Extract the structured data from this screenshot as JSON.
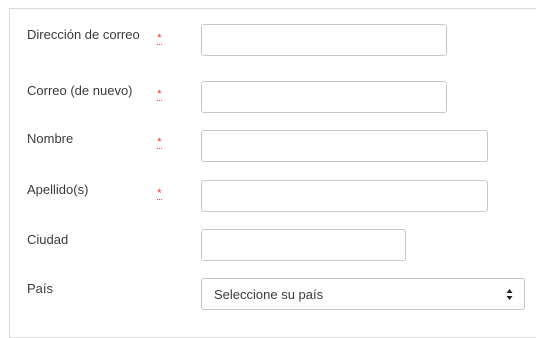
{
  "form": {
    "fields": [
      {
        "label": "Dirección de correo",
        "required": true,
        "value": ""
      },
      {
        "label": "Correo (de nuevo)",
        "required": true,
        "value": ""
      },
      {
        "label": "Nombre",
        "required": true,
        "value": ""
      },
      {
        "label": "Apellido(s)",
        "required": true,
        "value": ""
      },
      {
        "label": "Ciudad",
        "required": false,
        "value": ""
      },
      {
        "label": "País",
        "required": false,
        "value": "Seleccione su país"
      }
    ],
    "required_marker": "*"
  }
}
